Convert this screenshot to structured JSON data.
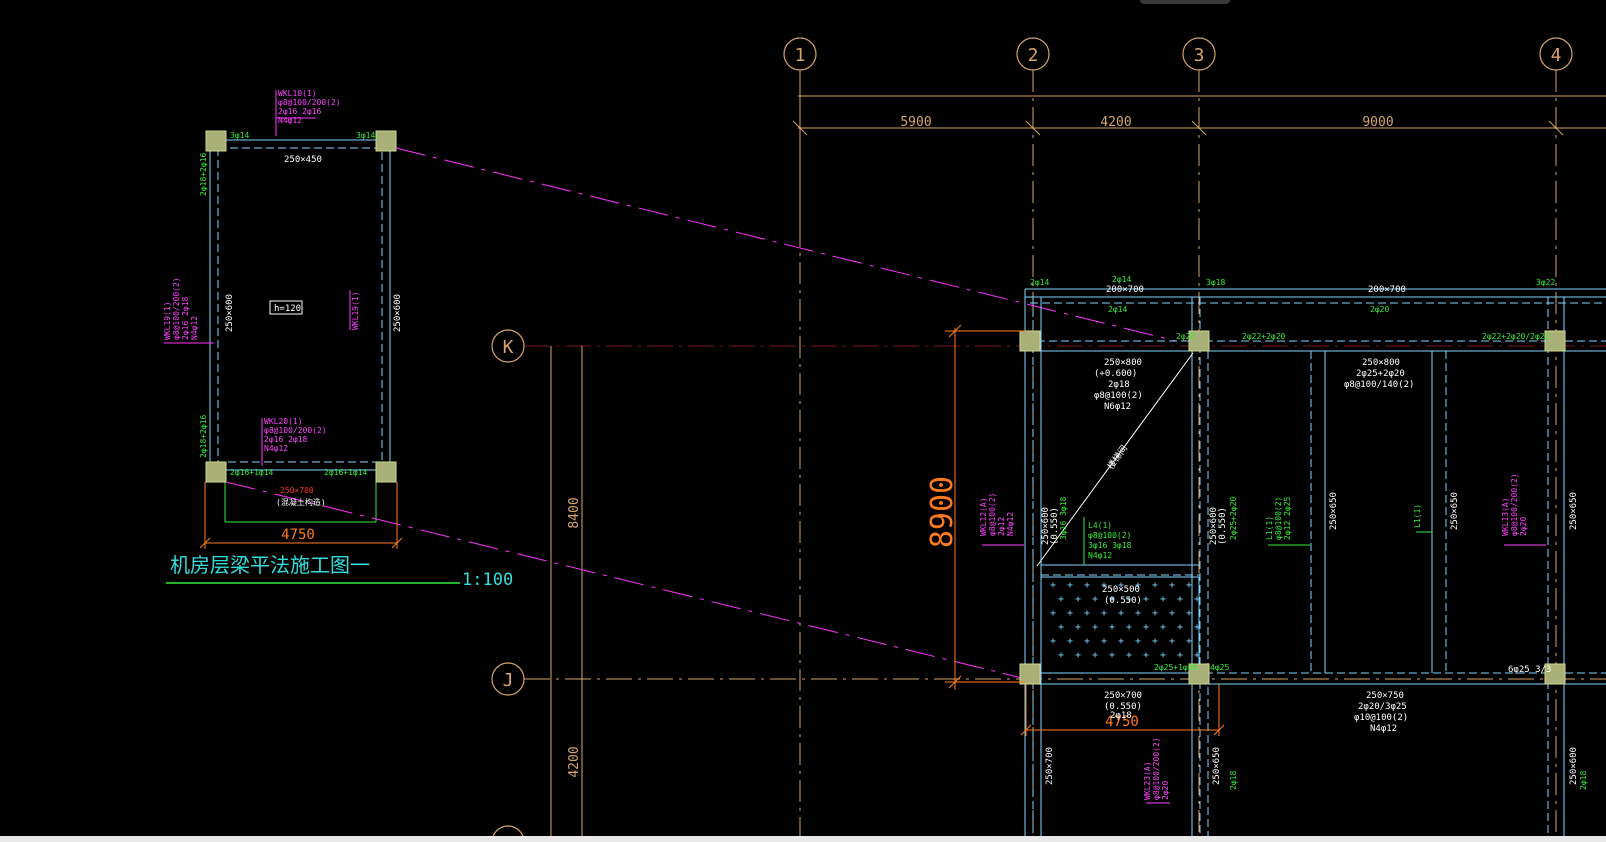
{
  "colors": {
    "background": "#000000",
    "axis": "#d8a46a",
    "beam": "#7fd4ff",
    "rebar_label": "#33ee33",
    "leader": "#ff33ff",
    "dimension": "#ff7a1a",
    "column_hatch": "#a8b078",
    "text": "#ffffff"
  },
  "grid_axes": {
    "vertical": [
      "1",
      "2",
      "3",
      "4"
    ],
    "horizontal": [
      "K",
      "J"
    ],
    "spans_x": [
      "5900",
      "4200",
      "9000"
    ],
    "spans_y": [
      "8400",
      "4200"
    ]
  },
  "dimensions": {
    "height_big": "8900",
    "width_main": "4750",
    "width_detail": "4750"
  },
  "detail": {
    "title": "机房层梁平法施工图一",
    "scale": "1:100",
    "slab_label": "h=120",
    "top_beam_id": "WKL10(1)",
    "top_beam_stirrup": "φ8@100/200(2)",
    "top_beam_main": "2φ16 2φ16",
    "top_beam_side": "N4φ12",
    "top_size": "250×450",
    "left_size": "250×600",
    "right_size": "250×600",
    "bottom_beam_id": "WKL20(1)",
    "bottom_beam_stirrup": "φ8@100/200(2)",
    "bottom_beam_main": "2φ16 2φ18",
    "bottom_beam_side": "N4φ12",
    "bottom_size": "250×700",
    "bottom_note": "(混凝土构造)",
    "left_beam_id": "WKL19(1)",
    "left_beam_stirrup": "φ8@100/200(2)",
    "left_beam_main": "2φ16 2φ18",
    "left_beam_side": "N4φ12",
    "right_beam_id": "WKL19(1)",
    "corner_tl": "3φ14",
    "corner_tr": "3φ14",
    "corner_bl": "2φ16+1φ14",
    "corner_br": "2φ16+1φ14",
    "left_top_bar": "2φ18+2φ16",
    "left_bot_bar": "2φ18+2φ16"
  },
  "main_plan": {
    "top_beam_size_1": "200×700",
    "top_beam_size_2": "200×700",
    "top_bar_1": "2φ14",
    "top_bar_2": "2φ14",
    "top_bar_3": "3φ18",
    "top_bar_4": "3φ22",
    "top_bar_5": "2φ14",
    "top_bar_6": "2φ20",
    "bar_k_2": "2φ22",
    "bar_k_3": "2φ22+2φ20",
    "bar_k_4": "2φ22+2φ20/2φ22",
    "beam_k_size": "250×800",
    "beam_k_elev": "(+0.600)",
    "beam_k_main": "2φ18",
    "beam_k_stirrup": "φ8@100(2)",
    "beam_k_side": "N6φ12",
    "beam_mid_size": "250×800",
    "beam_mid_main": "2φ25+2φ20",
    "beam_mid_stirrup": "φ8@100/140(2)",
    "stair_label": "楼梯间",
    "col_a_size": "250×600",
    "col_a_elev": "(0.550)",
    "col_b_size": "250×600",
    "col_b_elev": "(0.550)",
    "col_c_size": "250×650",
    "col_d_size": "250×650",
    "col_e_size": "250×650",
    "l4_id": "L4(1)",
    "l4_stirrup": "φ8@100(2)",
    "l4_main": "3φ16 3φ18",
    "l4_side": "N4φ12",
    "slab_size": "250×500",
    "slab_elev": "(0.550)",
    "bar_j_1": "2φ25+1φ20",
    "bar_j_2": "4φ25",
    "bar_j_3": "6φ25 3/3",
    "beam_j_size": "250×700",
    "beam_j_elev": "(0.550)",
    "beam_j_main": "2φ18",
    "beam_j_side": "N4φ12",
    "beam_j2_size": "250×750",
    "beam_j2_main": "2φ20/3φ25",
    "beam_j2_stirrup": "φ10@100(2)",
    "beam_j2_side": "N4φ12",
    "col_f_size": "250×700",
    "col_g_size": "250×650",
    "col_h_size": "250×600",
    "wkl_left_id": "WKL12(A)",
    "wkl_left_stirrup": "φ8@100(2)",
    "wkl_left_main": "2φ12",
    "wkl_left_side": "N4φ12",
    "wkl_right_id": "WKL13(A)",
    "wkl_right_stirrup": "φ8@100/200(2)",
    "wkl_right_main": "2φ20",
    "l1_id": "L1(1)",
    "l1_stirrup": "φ8@100(2)",
    "l1_main": "2φ12 2φ25",
    "l2_id": "L1(1)",
    "bot_wkl_id": "WKL23(A)",
    "bot_wkl_stirrup": "φ8@100/200(2)",
    "bot_wkl_main": "2φ20"
  }
}
